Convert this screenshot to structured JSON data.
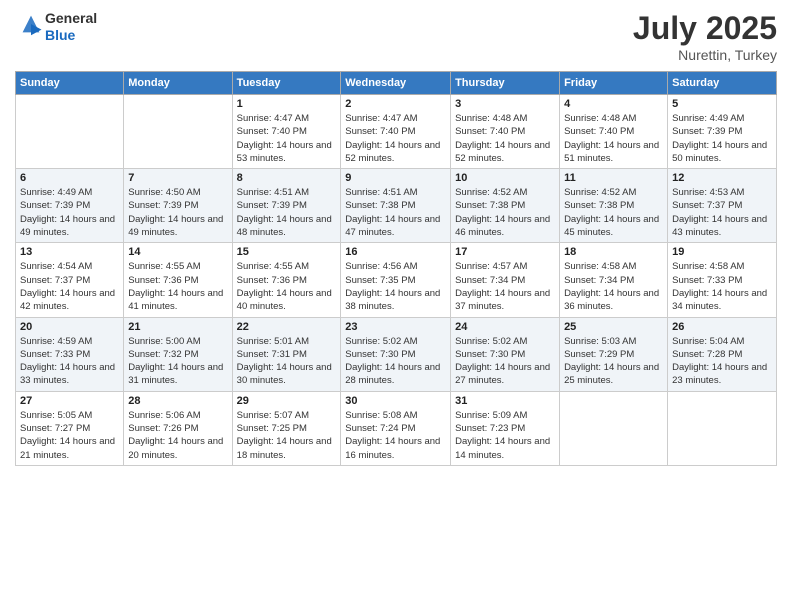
{
  "logo": {
    "general": "General",
    "blue": "Blue"
  },
  "title": "July 2025",
  "subtitle": "Nurettin, Turkey",
  "headers": [
    "Sunday",
    "Monday",
    "Tuesday",
    "Wednesday",
    "Thursday",
    "Friday",
    "Saturday"
  ],
  "weeks": [
    [
      {
        "day": "",
        "sunrise": "",
        "sunset": "",
        "daylight": ""
      },
      {
        "day": "",
        "sunrise": "",
        "sunset": "",
        "daylight": ""
      },
      {
        "day": "1",
        "sunrise": "Sunrise: 4:47 AM",
        "sunset": "Sunset: 7:40 PM",
        "daylight": "Daylight: 14 hours and 53 minutes."
      },
      {
        "day": "2",
        "sunrise": "Sunrise: 4:47 AM",
        "sunset": "Sunset: 7:40 PM",
        "daylight": "Daylight: 14 hours and 52 minutes."
      },
      {
        "day": "3",
        "sunrise": "Sunrise: 4:48 AM",
        "sunset": "Sunset: 7:40 PM",
        "daylight": "Daylight: 14 hours and 52 minutes."
      },
      {
        "day": "4",
        "sunrise": "Sunrise: 4:48 AM",
        "sunset": "Sunset: 7:40 PM",
        "daylight": "Daylight: 14 hours and 51 minutes."
      },
      {
        "day": "5",
        "sunrise": "Sunrise: 4:49 AM",
        "sunset": "Sunset: 7:39 PM",
        "daylight": "Daylight: 14 hours and 50 minutes."
      }
    ],
    [
      {
        "day": "6",
        "sunrise": "Sunrise: 4:49 AM",
        "sunset": "Sunset: 7:39 PM",
        "daylight": "Daylight: 14 hours and 49 minutes."
      },
      {
        "day": "7",
        "sunrise": "Sunrise: 4:50 AM",
        "sunset": "Sunset: 7:39 PM",
        "daylight": "Daylight: 14 hours and 49 minutes."
      },
      {
        "day": "8",
        "sunrise": "Sunrise: 4:51 AM",
        "sunset": "Sunset: 7:39 PM",
        "daylight": "Daylight: 14 hours and 48 minutes."
      },
      {
        "day": "9",
        "sunrise": "Sunrise: 4:51 AM",
        "sunset": "Sunset: 7:38 PM",
        "daylight": "Daylight: 14 hours and 47 minutes."
      },
      {
        "day": "10",
        "sunrise": "Sunrise: 4:52 AM",
        "sunset": "Sunset: 7:38 PM",
        "daylight": "Daylight: 14 hours and 46 minutes."
      },
      {
        "day": "11",
        "sunrise": "Sunrise: 4:52 AM",
        "sunset": "Sunset: 7:38 PM",
        "daylight": "Daylight: 14 hours and 45 minutes."
      },
      {
        "day": "12",
        "sunrise": "Sunrise: 4:53 AM",
        "sunset": "Sunset: 7:37 PM",
        "daylight": "Daylight: 14 hours and 43 minutes."
      }
    ],
    [
      {
        "day": "13",
        "sunrise": "Sunrise: 4:54 AM",
        "sunset": "Sunset: 7:37 PM",
        "daylight": "Daylight: 14 hours and 42 minutes."
      },
      {
        "day": "14",
        "sunrise": "Sunrise: 4:55 AM",
        "sunset": "Sunset: 7:36 PM",
        "daylight": "Daylight: 14 hours and 41 minutes."
      },
      {
        "day": "15",
        "sunrise": "Sunrise: 4:55 AM",
        "sunset": "Sunset: 7:36 PM",
        "daylight": "Daylight: 14 hours and 40 minutes."
      },
      {
        "day": "16",
        "sunrise": "Sunrise: 4:56 AM",
        "sunset": "Sunset: 7:35 PM",
        "daylight": "Daylight: 14 hours and 38 minutes."
      },
      {
        "day": "17",
        "sunrise": "Sunrise: 4:57 AM",
        "sunset": "Sunset: 7:34 PM",
        "daylight": "Daylight: 14 hours and 37 minutes."
      },
      {
        "day": "18",
        "sunrise": "Sunrise: 4:58 AM",
        "sunset": "Sunset: 7:34 PM",
        "daylight": "Daylight: 14 hours and 36 minutes."
      },
      {
        "day": "19",
        "sunrise": "Sunrise: 4:58 AM",
        "sunset": "Sunset: 7:33 PM",
        "daylight": "Daylight: 14 hours and 34 minutes."
      }
    ],
    [
      {
        "day": "20",
        "sunrise": "Sunrise: 4:59 AM",
        "sunset": "Sunset: 7:33 PM",
        "daylight": "Daylight: 14 hours and 33 minutes."
      },
      {
        "day": "21",
        "sunrise": "Sunrise: 5:00 AM",
        "sunset": "Sunset: 7:32 PM",
        "daylight": "Daylight: 14 hours and 31 minutes."
      },
      {
        "day": "22",
        "sunrise": "Sunrise: 5:01 AM",
        "sunset": "Sunset: 7:31 PM",
        "daylight": "Daylight: 14 hours and 30 minutes."
      },
      {
        "day": "23",
        "sunrise": "Sunrise: 5:02 AM",
        "sunset": "Sunset: 7:30 PM",
        "daylight": "Daylight: 14 hours and 28 minutes."
      },
      {
        "day": "24",
        "sunrise": "Sunrise: 5:02 AM",
        "sunset": "Sunset: 7:30 PM",
        "daylight": "Daylight: 14 hours and 27 minutes."
      },
      {
        "day": "25",
        "sunrise": "Sunrise: 5:03 AM",
        "sunset": "Sunset: 7:29 PM",
        "daylight": "Daylight: 14 hours and 25 minutes."
      },
      {
        "day": "26",
        "sunrise": "Sunrise: 5:04 AM",
        "sunset": "Sunset: 7:28 PM",
        "daylight": "Daylight: 14 hours and 23 minutes."
      }
    ],
    [
      {
        "day": "27",
        "sunrise": "Sunrise: 5:05 AM",
        "sunset": "Sunset: 7:27 PM",
        "daylight": "Daylight: 14 hours and 21 minutes."
      },
      {
        "day": "28",
        "sunrise": "Sunrise: 5:06 AM",
        "sunset": "Sunset: 7:26 PM",
        "daylight": "Daylight: 14 hours and 20 minutes."
      },
      {
        "day": "29",
        "sunrise": "Sunrise: 5:07 AM",
        "sunset": "Sunset: 7:25 PM",
        "daylight": "Daylight: 14 hours and 18 minutes."
      },
      {
        "day": "30",
        "sunrise": "Sunrise: 5:08 AM",
        "sunset": "Sunset: 7:24 PM",
        "daylight": "Daylight: 14 hours and 16 minutes."
      },
      {
        "day": "31",
        "sunrise": "Sunrise: 5:09 AM",
        "sunset": "Sunset: 7:23 PM",
        "daylight": "Daylight: 14 hours and 14 minutes."
      },
      {
        "day": "",
        "sunrise": "",
        "sunset": "",
        "daylight": ""
      },
      {
        "day": "",
        "sunrise": "",
        "sunset": "",
        "daylight": ""
      }
    ]
  ]
}
